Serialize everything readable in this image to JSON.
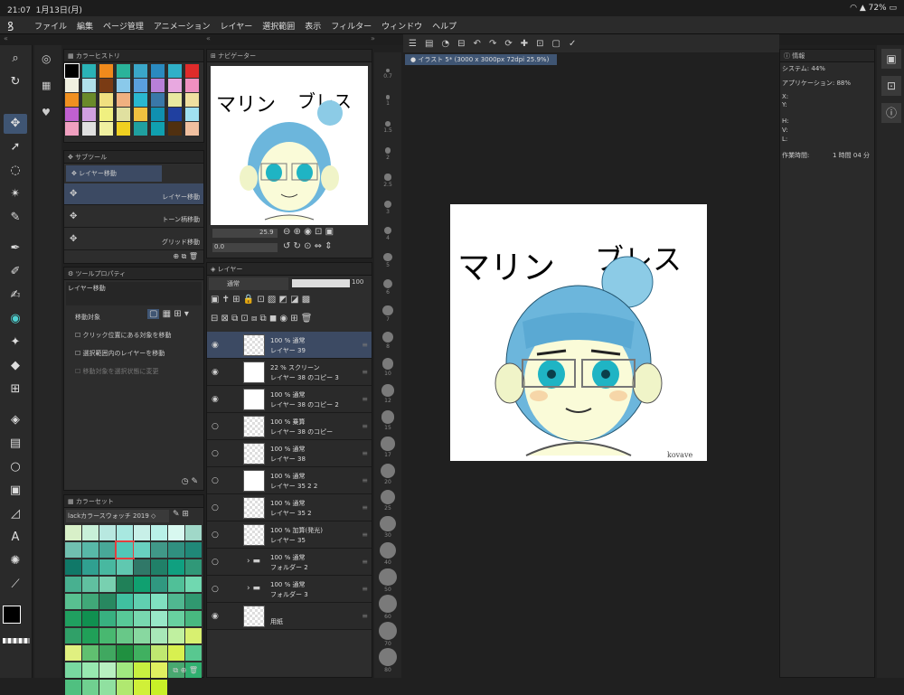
{
  "status": {
    "time": "21:07",
    "date": "1月13日(月)",
    "battery": "72%"
  },
  "menu": [
    "ファイル",
    "編集",
    "ページ管理",
    "アニメーション",
    "レイヤー",
    "選択範囲",
    "表示",
    "フィルター",
    "ウィンドウ",
    "ヘルプ"
  ],
  "color_history": {
    "title": "カラーヒストリ"
  },
  "subtool": {
    "title": "サブツール",
    "group": "レイヤー移動",
    "items": [
      "レイヤー移動",
      "トーン柄移動",
      "グリッド移動"
    ]
  },
  "tool_property": {
    "title": "ツールプロパティ",
    "name": "レイヤー移動",
    "target_label": "移動対象",
    "options": [
      "クリック位置にある対象を移動",
      "選択範囲内のレイヤーを移動",
      "移動対象を選択状態に変更"
    ]
  },
  "color_set": {
    "title": "カラーセット",
    "set_name": "lackカラースウォッチ 2019"
  },
  "navigator": {
    "title": "ナビゲーター",
    "zoom": "25.9",
    "rotation": "0.0"
  },
  "layers": {
    "title": "レイヤー",
    "blend": "通常",
    "opacity": "100",
    "items": [
      {
        "mode": "100 % 通常",
        "name": "レイヤー 39"
      },
      {
        "mode": "22 % スクリーン",
        "name": "レイヤー 38 のコピー 3"
      },
      {
        "mode": "100 % 通常",
        "name": "レイヤー 38 のコピー 2"
      },
      {
        "mode": "100 % 乗算",
        "name": "レイヤー 38 のコピー"
      },
      {
        "mode": "100 % 通常",
        "name": "レイヤー 38"
      },
      {
        "mode": "100 % 通常",
        "name": "レイヤー 35 2 2"
      },
      {
        "mode": "100 % 通常",
        "name": "レイヤー 35 2"
      },
      {
        "mode": "100 % 加算(発光)",
        "name": "レイヤー 35"
      },
      {
        "mode": "100 % 通常",
        "name": "フォルダー 2"
      },
      {
        "mode": "100 % 通常",
        "name": "フォルダー 3"
      },
      {
        "mode": "",
        "name": "用紙"
      }
    ]
  },
  "canvas": {
    "tab": "イラスト 5* (3000 x 3000px 72dpi 25.9%)",
    "text1": "マリン",
    "text2": "ブレス",
    "signature": "kovave"
  },
  "brush_sizes": [
    "0.7",
    "1",
    "1.5",
    "2",
    "2.5",
    "3",
    "4",
    "5",
    "6",
    "7",
    "8",
    "10",
    "12",
    "15",
    "17",
    "20",
    "25",
    "30",
    "40",
    "50",
    "60",
    "70",
    "80"
  ],
  "info": {
    "title": "情報",
    "system": "システム: 44%",
    "app": "アプリケーション: 88%",
    "x": "X:",
    "y": "Y:",
    "w": "H:",
    "v": "V:",
    "l": "L:",
    "time_label": "作業時間:",
    "time": "1 時間 04 分"
  },
  "colors": {
    "accent": "#3f5573",
    "canvas_bg": "#202020",
    "panel": "#2d2d2d"
  }
}
